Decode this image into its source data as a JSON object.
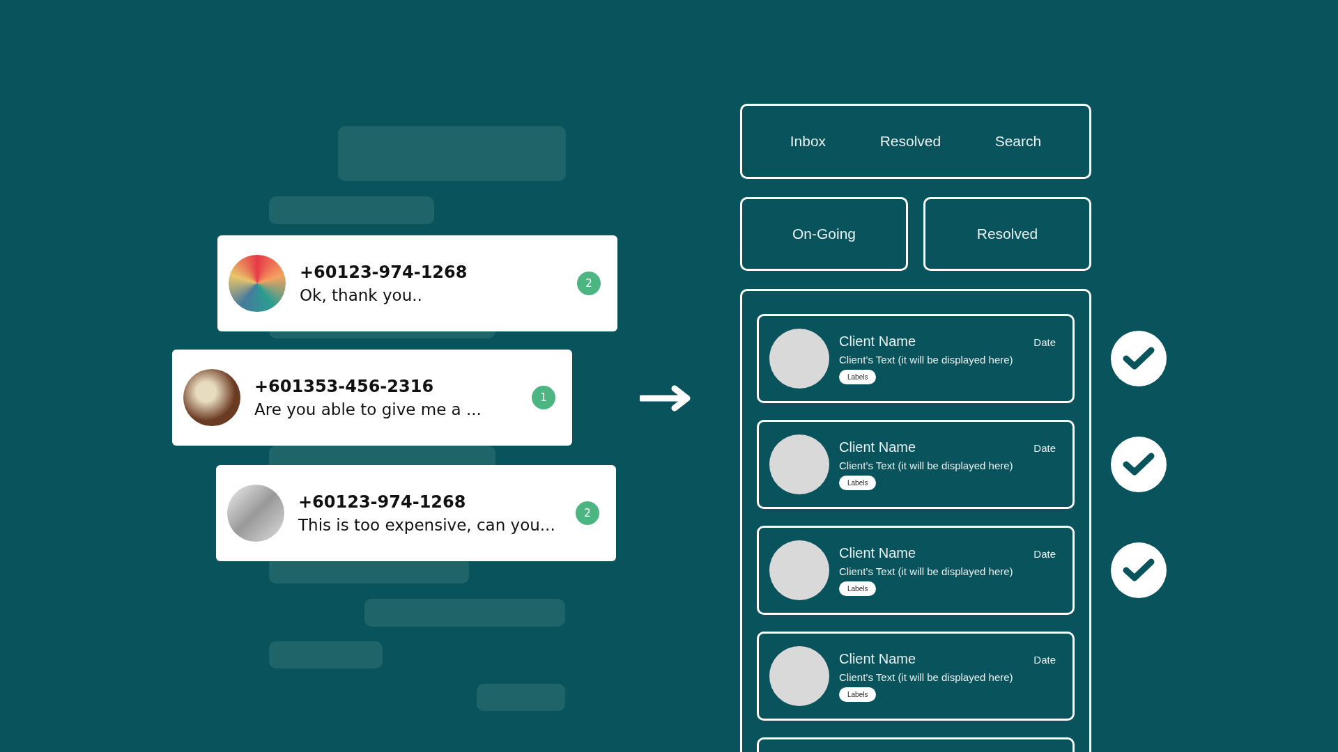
{
  "chats": [
    {
      "phone": "+60123-974-1268",
      "message": "Ok, thank you..",
      "unread": "2"
    },
    {
      "phone": "+601353-456-2316",
      "message": "Are you able to give me a ...",
      "unread": "1"
    },
    {
      "phone": "+60123-974-1268",
      "message": "This is too expensive, can you...",
      "unread": "2"
    }
  ],
  "tabs": [
    "Inbox",
    "Resolved",
    "Search"
  ],
  "filters": [
    "On-Going",
    "Resolved"
  ],
  "clients": [
    {
      "kind": "entry",
      "name": "Client Name",
      "date": "Date",
      "text": "Client’s Text (it will be displayed here)",
      "label": "Labels",
      "checked": true
    },
    {
      "kind": "entry",
      "name": "Client Name",
      "date": "Date",
      "text": "Client’s Text (it will be displayed here)",
      "label": "Labels",
      "checked": true
    },
    {
      "kind": "entry",
      "name": "Client Name",
      "date": "Date",
      "text": "Client’s Text (it will be displayed here)",
      "label": "Labels",
      "checked": true
    },
    {
      "kind": "entry",
      "name": "Client Name",
      "date": "Date",
      "text": "Client’s Text (it will be displayed here)",
      "label": "Labels",
      "checked": false
    },
    {
      "kind": "blank",
      "checked": false
    }
  ]
}
